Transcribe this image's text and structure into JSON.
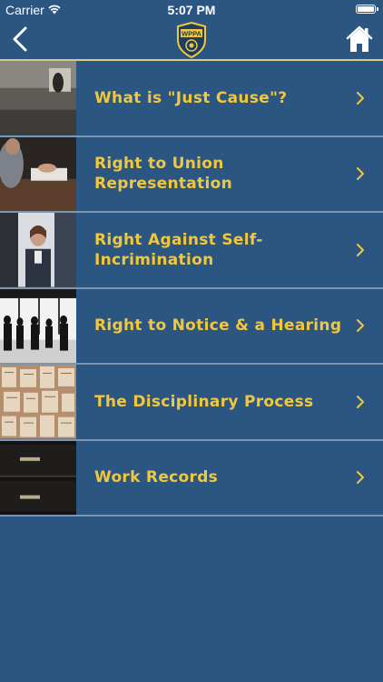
{
  "status_bar": {
    "carrier": "Carrier",
    "time": "5:07 PM",
    "battery_level": 1.0
  },
  "nav": {
    "logo_text": "WPPA",
    "back_icon": "chevron-left-icon",
    "home_icon": "home-icon"
  },
  "colors": {
    "background": "#2c5682",
    "accent": "#f1c73d",
    "divider": "#7d95ad",
    "nav_divider": "#d9c78c"
  },
  "menu": {
    "items": [
      {
        "label": "What is \"Just Cause\"?",
        "thumbnail": "desk-gavel-photo"
      },
      {
        "label": "Right to Union Representation",
        "thumbnail": "meeting-table-photo"
      },
      {
        "label": "Right Against Self-Incrimination",
        "thumbnail": "interview-photo"
      },
      {
        "label": "Right to Notice & a Hearing",
        "thumbnail": "silhouettes-photo"
      },
      {
        "label": "The Disciplinary Process",
        "thumbnail": "documents-photo"
      },
      {
        "label": "Work Records",
        "thumbnail": "file-drawers-photo"
      }
    ]
  }
}
